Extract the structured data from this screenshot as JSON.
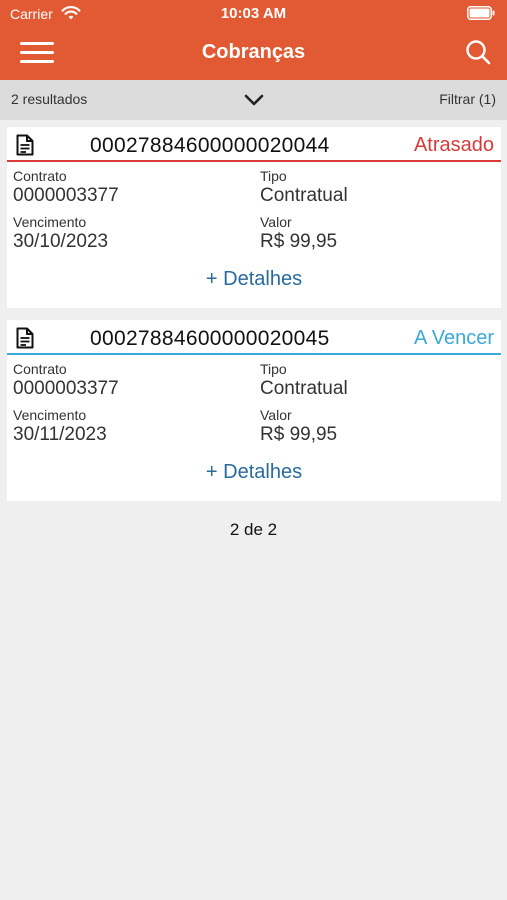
{
  "status_bar": {
    "carrier": "Carrier",
    "time": "10:03 AM"
  },
  "nav": {
    "title": "Cobranças",
    "menu_icon": "hamburger-menu-icon",
    "search_icon": "search-icon"
  },
  "results_bar": {
    "count": "2 resultados",
    "filter": "Filtrar (1)"
  },
  "cards": [
    {
      "number": "00027884600000020044",
      "status": "Atrasado",
      "status_color": "#d83a3a",
      "contract_label": "Contrato",
      "contract_value": "0000003377",
      "type_label": "Tipo",
      "type_value": "Contratual",
      "due_label": "Vencimento",
      "due_value": "30/10/2023",
      "amount_label": "Valor",
      "amount_value": "R$ 99,95",
      "details": "+ Detalhes"
    },
    {
      "number": "00027884600000020045",
      "status": "A Vencer",
      "status_color": "#3aa8d8",
      "contract_label": "Contrato",
      "contract_value": "0000003377",
      "type_label": "Tipo",
      "type_value": "Contratual",
      "due_label": "Vencimento",
      "due_value": "30/11/2023",
      "amount_label": "Valor",
      "amount_value": "R$ 99,95",
      "details": "+ Detalhes"
    }
  ],
  "pagination": "2 de 2",
  "colors": {
    "brand": "#e25a33",
    "link": "#2a6a9e",
    "background": "#efefef"
  }
}
